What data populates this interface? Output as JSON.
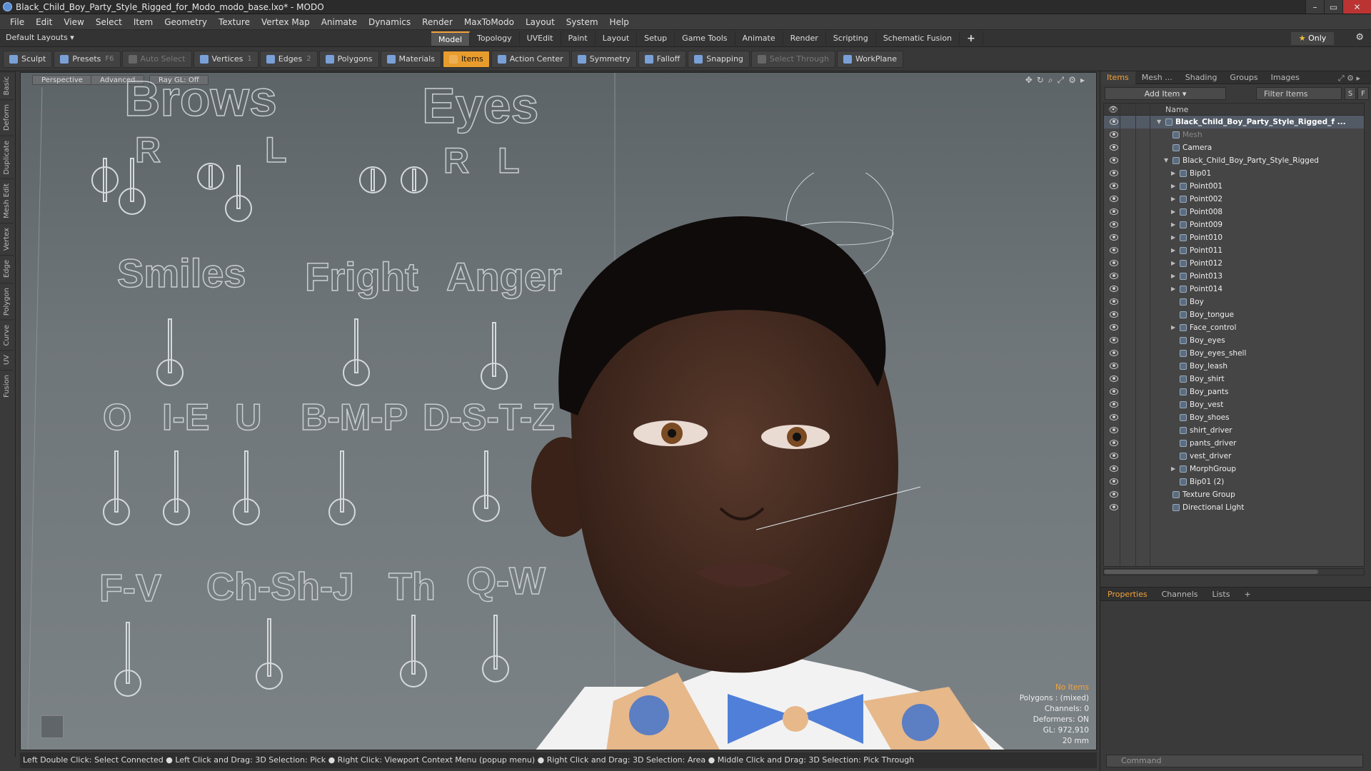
{
  "window": {
    "title": "Black_Child_Boy_Party_Style_Rigged_for_Modo_modo_base.lxo* - MODO",
    "buttons": [
      "–",
      "▭",
      "✕"
    ]
  },
  "menu": [
    "File",
    "Edit",
    "View",
    "Select",
    "Item",
    "Geometry",
    "Texture",
    "Vertex Map",
    "Animate",
    "Dynamics",
    "Render",
    "MaxToModo",
    "Layout",
    "System",
    "Help"
  ],
  "layout_bar": {
    "preset": "Default Layouts ▾",
    "tabs": [
      "Model",
      "Topology",
      "UVEdit",
      "Paint",
      "Layout",
      "Setup",
      "Game Tools",
      "Animate",
      "Render",
      "Scripting",
      "Schematic Fusion"
    ],
    "active_tab": "Model",
    "plus": "+",
    "only": "Only"
  },
  "toolbar": {
    "sculpt": "Sculpt",
    "presets": "Presets",
    "presets_key": "F6",
    "auto_select": "Auto Select",
    "vertices": "Vertices",
    "vertices_key": "1",
    "edges": "Edges",
    "edges_key": "2",
    "polygons": "Polygons",
    "materials": "Materials",
    "items": "Items",
    "action_center": "Action Center",
    "symmetry": "Symmetry",
    "falloff": "Falloff",
    "snapping": "Snapping",
    "select_through": "Select Through",
    "workplane": "WorkPlane"
  },
  "left_strip": [
    "Basic",
    "Deform",
    "Duplicate",
    "Mesh Edit",
    "Vertex",
    "Edge",
    "Polygon",
    "Curve",
    "UV",
    "Fusion"
  ],
  "viewport": {
    "view_tab": "Perspective",
    "advanced_tab": "Advanced",
    "raygl_tab": "Ray GL: Off",
    "rig_labels": {
      "brows": "Brows",
      "eyes": "Eyes",
      "brows_r": "R",
      "brows_l": "L",
      "eyes_r": "R",
      "eyes_l": "L",
      "smiles": "Smiles",
      "fright": "Fright",
      "anger": "Anger",
      "o": "O",
      "ie": "I-E",
      "u": "U",
      "bmp": "B-M-P",
      "dstz": "D-S-T-Z",
      "fv": "F-V",
      "chshj": "Ch-Sh-J",
      "th": "Th",
      "qw": "Q-W"
    },
    "info": {
      "no_items": "No Items",
      "polygons": "Polygons : (mixed)",
      "channels": "Channels: 0",
      "deformers": "Deformers: ON",
      "gl": "GL: 972,910",
      "scale": "20 mm"
    }
  },
  "status": "Left Double Click: Select Connected ● Left Click and Drag: 3D Selection: Pick ● Right Click: Viewport Context Menu (popup menu) ● Right Click and Drag: 3D Selection: Area ● Middle Click and Drag: 3D Selection: Pick Through",
  "panel": {
    "tabs": [
      "Items",
      "Mesh ...",
      "Shading",
      "Groups",
      "Images"
    ],
    "active_tab": "Items",
    "add_item": "Add Item",
    "filter": "Filter Items",
    "col_name": "Name",
    "tree": [
      {
        "label": "Black_Child_Boy_Party_Style_Rigged_f ...",
        "depth": 0,
        "style": "bold"
      },
      {
        "label": "Mesh",
        "depth": 1,
        "style": "dim"
      },
      {
        "label": "Camera",
        "depth": 1,
        "style": ""
      },
      {
        "label": "Black_Child_Boy_Party_Style_Rigged",
        "depth": 1,
        "style": ""
      },
      {
        "label": "Bip01",
        "depth": 2,
        "style": ""
      },
      {
        "label": "Point001",
        "depth": 2,
        "style": ""
      },
      {
        "label": "Point002",
        "depth": 2,
        "style": ""
      },
      {
        "label": "Point008",
        "depth": 2,
        "style": ""
      },
      {
        "label": "Point009",
        "depth": 2,
        "style": ""
      },
      {
        "label": "Point010",
        "depth": 2,
        "style": ""
      },
      {
        "label": "Point011",
        "depth": 2,
        "style": ""
      },
      {
        "label": "Point012",
        "depth": 2,
        "style": ""
      },
      {
        "label": "Point013",
        "depth": 2,
        "style": ""
      },
      {
        "label": "Point014",
        "depth": 2,
        "style": ""
      },
      {
        "label": "Boy",
        "depth": 2,
        "style": ""
      },
      {
        "label": "Boy_tongue",
        "depth": 2,
        "style": ""
      },
      {
        "label": "Face_control",
        "depth": 2,
        "style": ""
      },
      {
        "label": "Boy_eyes",
        "depth": 2,
        "style": ""
      },
      {
        "label": "Boy_eyes_shell",
        "depth": 2,
        "style": ""
      },
      {
        "label": "Boy_leash",
        "depth": 2,
        "style": ""
      },
      {
        "label": "Boy_shirt",
        "depth": 2,
        "style": ""
      },
      {
        "label": "Boy_pants",
        "depth": 2,
        "style": ""
      },
      {
        "label": "Boy_vest",
        "depth": 2,
        "style": ""
      },
      {
        "label": "Boy_shoes",
        "depth": 2,
        "style": ""
      },
      {
        "label": "shirt_driver",
        "depth": 2,
        "style": ""
      },
      {
        "label": "pants_driver",
        "depth": 2,
        "style": ""
      },
      {
        "label": "vest_driver",
        "depth": 2,
        "style": ""
      },
      {
        "label": "MorphGroup",
        "depth": 2,
        "style": ""
      },
      {
        "label": "Bip01 (2)",
        "depth": 2,
        "style": ""
      },
      {
        "label": "Texture Group",
        "depth": 1,
        "style": ""
      },
      {
        "label": "Directional Light",
        "depth": 1,
        "style": ""
      }
    ],
    "props_tabs": [
      "Properties",
      "Channels",
      "Lists",
      "+"
    ],
    "props_active": "Properties",
    "command_placeholder": "Command"
  },
  "colors": {
    "accent": "#f3a33b",
    "selection": "#525a66"
  }
}
